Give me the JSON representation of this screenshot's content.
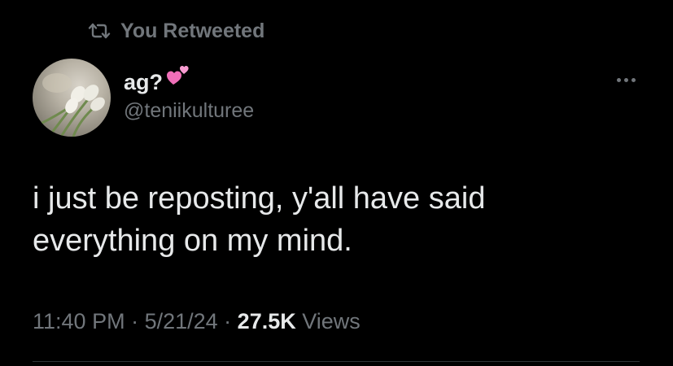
{
  "retweet_banner": {
    "icon": "retweet-icon",
    "text": "You Retweeted"
  },
  "author": {
    "avatar": "avatar-tulips-image",
    "display_name": "ag?",
    "emoji": "heart-emoji",
    "handle": "@teniikulturee"
  },
  "more_menu": {
    "icon": "more-options-icon"
  },
  "tweet": {
    "text": "i just be reposting, y'all have said\neverything on my mind."
  },
  "meta": {
    "time": "11:40 PM",
    "separator1": " · ",
    "date": "5/21/24",
    "separator2": " · ",
    "views_count": "27.5K",
    "views_label": " Views"
  },
  "colors": {
    "background": "#000000",
    "primary_text": "#e7e9ea",
    "secondary_text": "#71767b",
    "divider": "#2f3336",
    "heart": "#f06fb8"
  }
}
